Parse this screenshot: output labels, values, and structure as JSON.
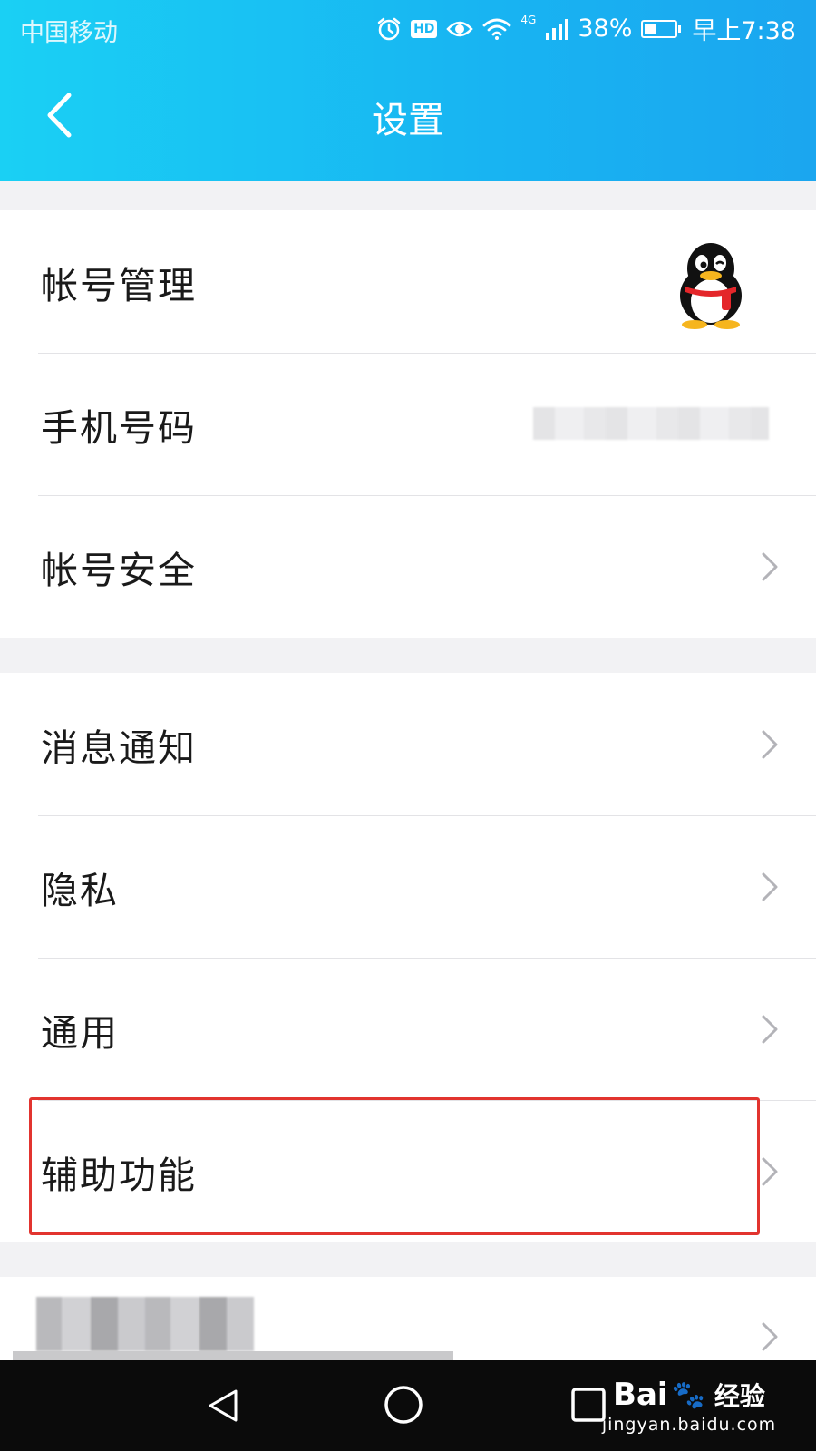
{
  "status_bar": {
    "carrier": "中国移动",
    "hd_badge": "HD",
    "network": "4G",
    "battery_percent": "38%",
    "battery_level": 0.38,
    "time": "早上7:38"
  },
  "header": {
    "title": "设置"
  },
  "sections": [
    {
      "rows": [
        {
          "label": "帐号管理",
          "trailing": "avatar"
        },
        {
          "label": "手机号码",
          "trailing": "blurred-value"
        },
        {
          "label": "帐号安全",
          "trailing": "chevron"
        }
      ]
    },
    {
      "rows": [
        {
          "label": "消息通知",
          "trailing": "chevron"
        },
        {
          "label": "隐私",
          "trailing": "chevron"
        },
        {
          "label": "通用",
          "trailing": "chevron"
        },
        {
          "label": "辅助功能",
          "trailing": "chevron",
          "highlighted": true
        }
      ]
    }
  ],
  "watermark": {
    "brand_left": "Bai",
    "brand_right": "经验",
    "url": "jingyan.baidu.com"
  },
  "colors": {
    "header_start": "#1ad0f4",
    "header_end": "#1ba6ef",
    "highlight": "#e2342f",
    "background": "#f2f2f4"
  },
  "icons": [
    "back-icon",
    "chevron-right-icon",
    "penguin-avatar-icon",
    "alarm-icon",
    "eye-icon",
    "wifi-icon",
    "signal-icon",
    "battery-icon",
    "system-back-icon",
    "system-home-icon",
    "system-recent-icon",
    "baidu-paw-icon"
  ]
}
